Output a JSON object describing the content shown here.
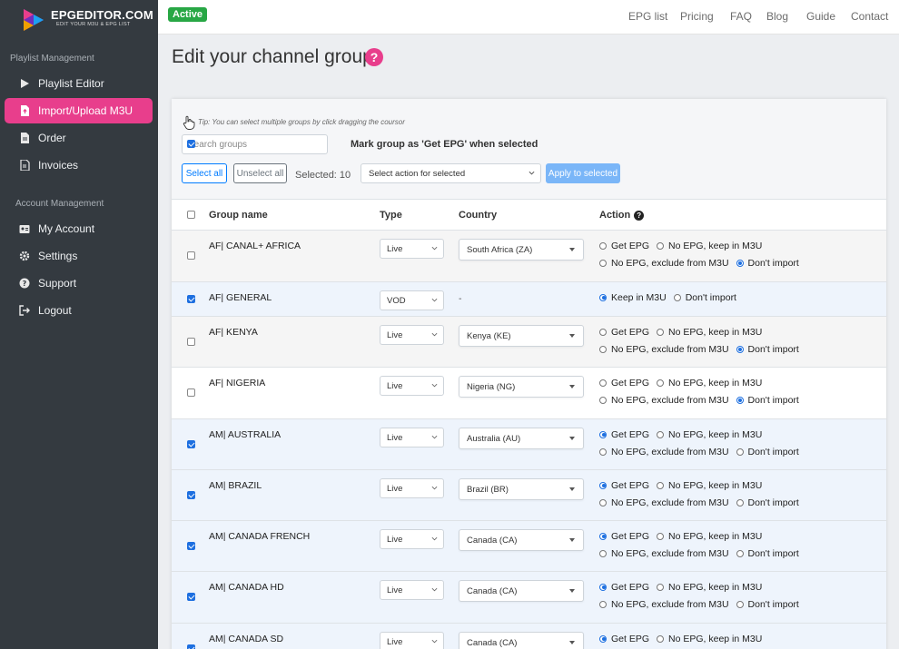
{
  "brand": {
    "name": "EPGEDITOR.COM",
    "tagline": "EDIT YOUR M3U & EPG LIST"
  },
  "status_badge": "Active",
  "nav": [
    "EPG list",
    "Pricing",
    "FAQ",
    "Blog",
    "Guide",
    "Contact"
  ],
  "sidebar": {
    "section1": "Playlist Management",
    "items1": [
      {
        "label": "Playlist Editor",
        "icon": "play-icon"
      },
      {
        "label": "Import/Upload M3U",
        "icon": "file-upload-icon",
        "active": true
      },
      {
        "label": "Order",
        "icon": "document-icon"
      },
      {
        "label": "Invoices",
        "icon": "invoice-icon"
      }
    ],
    "section2": "Account Management",
    "items2": [
      {
        "label": "My Account",
        "icon": "id-card-icon"
      },
      {
        "label": "Settings",
        "icon": "gear-icon"
      },
      {
        "label": "Support",
        "icon": "question-circle-icon"
      },
      {
        "label": "Logout",
        "icon": "logout-icon"
      }
    ]
  },
  "page": {
    "title": "Edit your channel groups",
    "help": "?"
  },
  "toolbar": {
    "tip": "Tip: You can select multiple groups by click dragging the coursor",
    "search_placeholder": "Search groups",
    "mark_label": "Mark group as 'Get EPG' when selected",
    "select_all": "Select all",
    "unselect_all": "Unselect all",
    "selected_count": "Selected: 10",
    "action_placeholder": "Select action for selected",
    "apply": "Apply to selected"
  },
  "table": {
    "headers": {
      "group": "Group name",
      "type": "Type",
      "country": "Country",
      "action": "Action"
    },
    "options": {
      "get_epg": "Get EPG",
      "no_epg_keep": "No EPG, keep in M3U",
      "no_epg_exclude": "No EPG, exclude from M3U",
      "dont_import": "Don't import",
      "keep": "Keep in M3U"
    },
    "rows": [
      {
        "name": "AF| CANAL+ AFRICA",
        "checked": false,
        "type": "Live",
        "country": "South Africa (ZA)",
        "action": "dont_import"
      },
      {
        "name": "AF| GENERAL",
        "checked": true,
        "type": "VOD",
        "country": "-",
        "action": "keep"
      },
      {
        "name": "AF| KENYA",
        "checked": false,
        "type": "Live",
        "country": "Kenya (KE)",
        "action": "dont_import"
      },
      {
        "name": "AF| NIGERIA",
        "checked": false,
        "type": "Live",
        "country": "Nigeria (NG)",
        "action": "dont_import"
      },
      {
        "name": "AM| AUSTRALIA",
        "checked": true,
        "type": "Live",
        "country": "Australia (AU)",
        "action": "get_epg"
      },
      {
        "name": "AM| BRAZIL",
        "checked": true,
        "type": "Live",
        "country": "Brazil (BR)",
        "action": "get_epg"
      },
      {
        "name": "AM| CANADA FRENCH",
        "checked": true,
        "type": "Live",
        "country": "Canada (CA)",
        "action": "get_epg"
      },
      {
        "name": "AM| CANADA HD",
        "checked": true,
        "type": "Live",
        "country": "Canada (CA)",
        "action": "get_epg"
      },
      {
        "name": "AM| CANADA SD",
        "checked": true,
        "type": "Live",
        "country": "Canada (CA)",
        "action": "get_epg"
      }
    ]
  }
}
